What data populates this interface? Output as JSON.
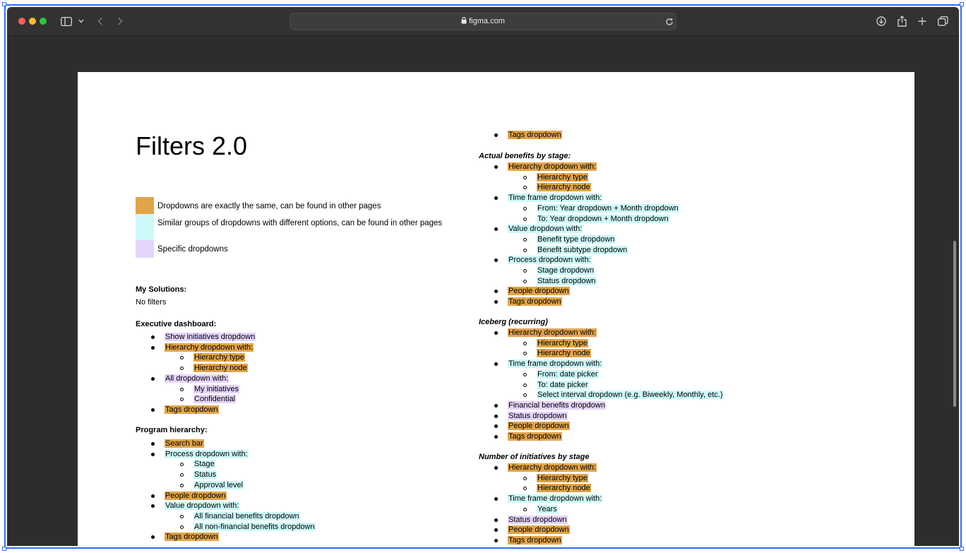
{
  "browser": {
    "url": "figma.com",
    "colors": {
      "close": "#fe5f57",
      "minimize": "#febc2e",
      "maximize": "#28c840"
    }
  },
  "doc": {
    "title": "Filters 2.0",
    "legend": [
      {
        "color": "#e1a448",
        "text": "Dropdowns are exactly the same, can be found in other pages"
      },
      {
        "color": "#cdf9fb",
        "text": "Similar groups of dropdowns with different options, can be found in other pages"
      },
      {
        "color": "#e5d4fb",
        "text": "Specific dropdowns"
      }
    ],
    "left": {
      "my_solutions": {
        "heading": "My Solutions:",
        "note": "No filters"
      },
      "executive": {
        "heading": "Executive dashboard:",
        "items": [
          "Show initiatives dropdown",
          "Hierarchy dropdown with:",
          "Hierarchy type",
          "Hierarchy node",
          "All dropdown with:",
          "My initiatives",
          "Confidential",
          "Tags dropdown"
        ]
      },
      "program": {
        "heading": "Program hierarchy:",
        "items": [
          "Search bar",
          "Process dropdown with:",
          "Stage",
          "Status",
          "Approval level",
          "People dropdown",
          "Value dropdown with:",
          "All financial benefits dropdown",
          "All non-financial benefits dropdown",
          "Tags dropdown"
        ]
      }
    },
    "right": {
      "top_item": "Tags dropdown",
      "actual": {
        "heading": "Actual benefits by stage:",
        "items": [
          "Hierarchy dropdown with:",
          "Hierarchy type",
          "Hierarchy node",
          "Time frame dropdown with:",
          "From: Year dropdown + Month dropdown",
          "To: Year dropdown + Month dropdown",
          "Value dropdown with:",
          "Benefit type dropdown",
          "Benefit subtype dropdown",
          "Process dropdown with:",
          "Stage dropdown",
          "Status dropdown",
          "People dropdown",
          "Tags dropdown"
        ]
      },
      "iceberg": {
        "heading": "Iceberg (recurring)",
        "items": [
          "Hierarchy dropdown with:",
          "Hierarchy type",
          "Hierarchy node",
          "Time frame dropdown with:",
          "From: date picker",
          "To: date picker",
          "Select interval dropdown (e.g. Biweekly, Monthly, etc.)",
          "Financial benefits dropdown",
          "Status dropdown",
          "People dropdown",
          "Tags dropdown"
        ]
      },
      "initiatives": {
        "heading": "Number of initiatives by stage",
        "items": [
          "Hierarchy dropdown with:",
          "Hierarchy type",
          "Hierarchy node",
          "Time frame dropdown with:",
          "Years",
          "Status dropdown",
          "People dropdown",
          "Tags dropdown"
        ]
      }
    }
  }
}
